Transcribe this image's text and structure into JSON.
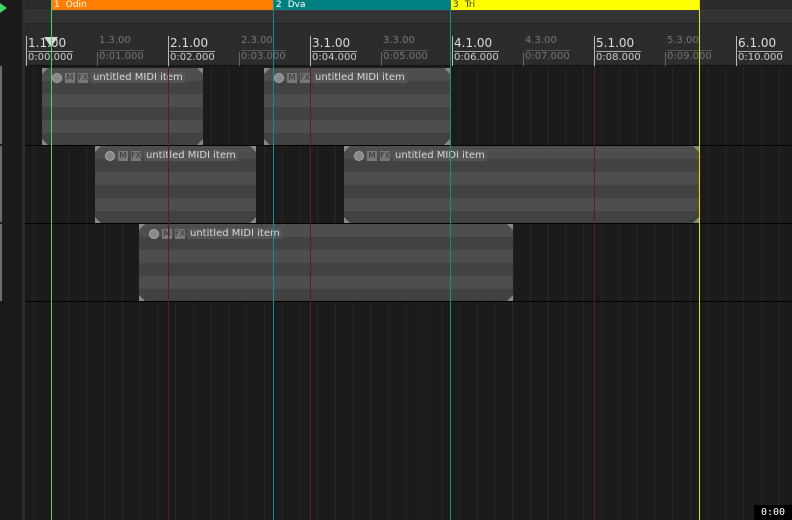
{
  "regions": [
    {
      "number": "1",
      "name": "Odin",
      "color": "#ff8000"
    },
    {
      "number": "2",
      "name": "Dva",
      "color": "#008080"
    },
    {
      "number": "3",
      "name": "Tri",
      "color": "#ffff00"
    }
  ],
  "ruler": {
    "major": [
      {
        "bar": "1.1.00",
        "time": "0:00.000"
      },
      {
        "bar": "2.1.00",
        "time": "0:02.000"
      },
      {
        "bar": "3.1.00",
        "time": "0:04.000"
      },
      {
        "bar": "4.1.00",
        "time": "0:06.000"
      },
      {
        "bar": "5.1.00",
        "time": "0:08.000"
      },
      {
        "bar": "6.1.00",
        "time": "0:10.000"
      }
    ],
    "minor": [
      {
        "bar": "1.3.00",
        "time": "0:01.000"
      },
      {
        "bar": "2.3.00",
        "time": "0:03.000"
      },
      {
        "bar": "3.3.00",
        "time": "0:05.000"
      },
      {
        "bar": "4.3.00",
        "time": "0:07.000"
      },
      {
        "bar": "5.3.00",
        "time": "0:09.000"
      }
    ]
  },
  "items": [
    {
      "label": "untitled MIDI item",
      "mute_btn": "M",
      "fx_btn": "FX"
    },
    {
      "label": "untitled MIDI item",
      "mute_btn": "M",
      "fx_btn": "FX"
    },
    {
      "label": "untitled MIDI item",
      "mute_btn": "M",
      "fx_btn": "FX"
    },
    {
      "label": "untitled MIDI item",
      "mute_btn": "M",
      "fx_btn": "FX"
    },
    {
      "label": "untitled MIDI item",
      "mute_btn": "M",
      "fx_btn": "FX"
    }
  ],
  "status": {
    "time_readout": "0:00"
  },
  "colors": {
    "edit_cursor": "#3fd86a",
    "region1": "#ff8000",
    "region2": "#008080",
    "region3": "#ffff00",
    "loop_line": "#7a1a1a"
  }
}
